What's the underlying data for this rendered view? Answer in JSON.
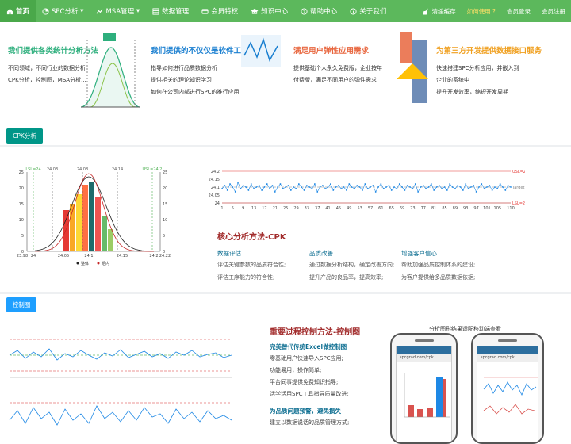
{
  "nav": {
    "home": "首页",
    "spc": "SPC分析",
    "msa": "MSA管理",
    "data": "数据管理",
    "member": "会员特权",
    "knowledge": "知识中心",
    "help": "帮助中心",
    "about": "关于我们",
    "clear_cache": "清缓缓存",
    "how_to_use": "如何使用",
    "login": "会员登录",
    "register": "会员注册"
  },
  "features": [
    {
      "title": "我们提供各类统计分析方法",
      "color": "#2eaf7d",
      "lines": [
        "不同领域，不同行业的数据分析",
        "CPK分析，控制图，MSA分析..."
      ]
    },
    {
      "title": "我们提供的不仅仅是软件工具",
      "color": "#1a7fd0",
      "lines": [
        "指导如何进行品质数据分析",
        "提供相关的理论知识学习",
        "如何在公司内部进行SPC的推行应用"
      ]
    },
    {
      "title": "满足用户弹性应用需求",
      "color": "#e8663e",
      "lines": [
        "提供基础个人永久免费版，企业按年",
        "付费版，满足不同用户的弹性需求"
      ]
    },
    {
      "title": "为第三方开发提供数据接口服务",
      "color": "#f0a020",
      "lines": [
        "快速搭建SPC分析应用，并嵌入到",
        "企业的系统中",
        "提升开发效率，缩短开发周期"
      ]
    }
  ],
  "cpk_tag": "CPK分析",
  "control_tag": "控制图",
  "cpk": {
    "title": "核心分析方法-CPK",
    "cols": [
      {
        "head": "数据评估",
        "lines": [
          "评估关键参数的品质符合性;",
          "评估工序能力的符合性;"
        ]
      },
      {
        "head": "品质改善",
        "lines": [
          "通过数据分析结构，确定改善方向;",
          "提升产品的良品率，提高效率;"
        ]
      },
      {
        "head": "增强客户信心",
        "lines": [
          "帮助加强品质控制体系的建设;",
          "为客户提供给多品质数据依据;"
        ]
      }
    ]
  },
  "control": {
    "title": "重要过程控制方法-控制图",
    "head1": "完美替代传统Excel做控制图",
    "lines1": [
      "零基础用户快速导入SPC应用;",
      "功能易用，操作简单;",
      "平台同事提供免费知识指导;",
      "活学活用SPC工具指导质量改进;"
    ],
    "head2": "为品质问题预警，避免损失",
    "lines2": [
      "建立以数据说话的品质管理方式;"
    ]
  },
  "mobile_caption": "分析图形结果适配移动端查看",
  "phone_url": "spcgrad.com/cpk",
  "chart_data": [
    {
      "type": "bar",
      "title": "",
      "categories": [
        "24.06",
        "24.07",
        "24.08",
        "24.09",
        "24.1",
        "24.11",
        "24.12",
        "24.13"
      ],
      "values": [
        13,
        15,
        18,
        21,
        22,
        17,
        11,
        7
      ],
      "spec_labels": {
        "LSL": "LSL=24",
        "target": "24.08",
        "USL": "USL=24.2",
        "x1": "24.03",
        "x2": "24.14"
      },
      "xticks": [
        "23.98",
        "24",
        "24.05",
        "24.1",
        "24.15",
        "24.2",
        "24.22"
      ],
      "yticks": [
        "0",
        "5",
        "10",
        "15",
        "20",
        "25"
      ],
      "legend": [
        "整体",
        "组内"
      ],
      "ylim": [
        0,
        25
      ]
    },
    {
      "type": "line",
      "title": "",
      "xlabel": "",
      "ylabel": "",
      "ylim": [
        24,
        24.2
      ],
      "yticks": [
        "24",
        "24.05",
        "24.1",
        "24.15",
        "24.2"
      ],
      "xticks": [
        "1",
        "5",
        "9",
        "13",
        "17",
        "21",
        "25",
        "29",
        "33",
        "37",
        "41",
        "45",
        "49",
        "53",
        "57",
        "61",
        "65",
        "69",
        "73",
        "77",
        "81",
        "85",
        "89",
        "93",
        "97",
        "101",
        "105",
        "110"
      ],
      "limits": {
        "USL": "USL=24.2",
        "LSL": "LSL=24",
        "target": "Target=24.1"
      },
      "values": [
        24.09,
        24.11,
        24.08,
        24.12,
        24.1,
        24.07,
        24.13,
        24.09,
        24.11,
        24.1,
        24.08,
        24.12,
        24.09,
        24.1,
        24.11,
        24.08,
        24.1,
        24.12,
        24.09,
        24.11,
        24.07,
        24.1,
        24.12,
        24.09,
        24.1,
        24.11,
        24.08,
        24.1,
        24.09,
        24.12,
        24.1,
        24.08,
        24.11,
        24.1,
        24.09,
        24.12,
        24.07,
        24.1,
        24.11,
        24.09,
        24.1,
        24.12,
        24.08,
        24.1,
        24.11,
        24.09,
        24.1,
        24.08,
        24.12,
        24.1,
        24.09,
        24.11,
        24.1,
        24.08,
        24.12,
        24.09,
        24.1,
        24.11,
        24.07,
        24.1,
        24.12,
        24.09,
        24.1,
        24.11,
        24.08,
        24.1,
        24.09,
        24.12,
        24.1,
        24.08,
        24.11,
        24.1,
        24.09,
        24.12,
        24.07,
        24.1,
        24.11,
        24.09,
        24.1,
        24.12,
        24.08,
        24.1,
        24.11,
        24.09,
        24.1,
        24.08,
        24.12,
        24.1,
        24.09,
        24.11,
        24.1,
        24.08,
        24.12,
        24.09,
        24.1,
        24.11,
        24.07,
        24.1,
        24.12,
        24.09,
        24.1,
        24.11,
        24.08,
        24.1,
        24.09,
        24.12,
        24.1,
        24.08,
        24.11,
        24.1
      ]
    }
  ]
}
